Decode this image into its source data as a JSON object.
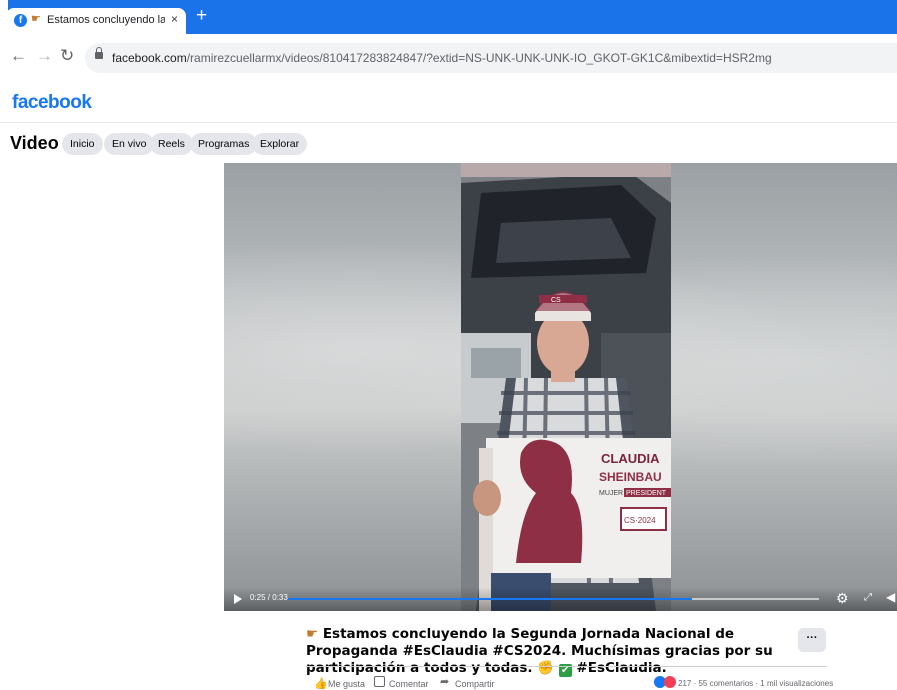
{
  "browser": {
    "tab_title": "Estamos concluyendo la Segu",
    "tab_close": "×",
    "new_tab": "+",
    "url_domain": "facebook.com",
    "url_path": "/ramirezcuellarmx/videos/810417283824847/?extid=NS-UNK-UNK-UNK-IO_GKOT-GK1C&mibextid=HSR2mg",
    "accent_color": "#1a73e8"
  },
  "header": {
    "logo": "facebook",
    "brand_color": "#1877f2",
    "section_title": "Video",
    "pills": [
      "Inicio",
      "En vivo",
      "Reels",
      "Programas",
      "Explorar"
    ]
  },
  "player": {
    "time": "0:25 / 0:33",
    "progress_fraction": 0.76
  },
  "post": {
    "caption_part1": "Estamos concluyendo la Segunda Jornada Nacional de Propaganda #EsClaudia #CS2024. Muchísimas gracias por su participación a todos y todas. ",
    "caption_part2": " #EsClaudia.",
    "more_label": "···",
    "like_label": "Me gusta",
    "comment_label": "Comentar",
    "share_label": "Compartir",
    "reaction_count": "217",
    "stats": "55 comentarios · 1 mil visualizaciones"
  }
}
